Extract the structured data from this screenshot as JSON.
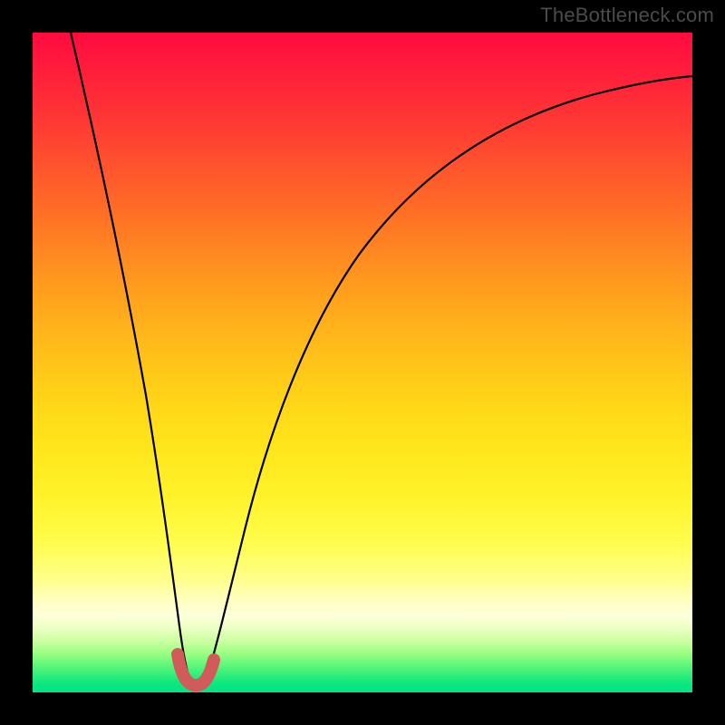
{
  "watermark": "TheBottleneck.com",
  "chart_data": {
    "type": "line",
    "title": "",
    "xlabel": "",
    "ylabel": "",
    "xlim": [
      0,
      100
    ],
    "ylim": [
      0,
      100
    ],
    "grid": false,
    "legend": false,
    "series": [
      {
        "name": "bottleneck-curve",
        "x": [
          0,
          3,
          6,
          9,
          12,
          15,
          18,
          21,
          23,
          25,
          28,
          32,
          36,
          40,
          45,
          50,
          55,
          60,
          65,
          70,
          75,
          80,
          85,
          90,
          95,
          100
        ],
        "values": [
          100,
          88,
          76,
          64,
          52,
          40,
          28,
          15,
          4,
          3,
          14,
          28,
          41,
          51,
          60,
          67,
          73,
          77,
          81,
          84,
          86,
          88,
          90,
          91,
          92,
          93
        ]
      }
    ],
    "marker": {
      "name": "optimal-range",
      "x_range": [
        21.5,
        26.5
      ],
      "y_range": [
        0,
        6
      ]
    },
    "colors": {
      "curve": "#000000",
      "marker": "#d15a5a",
      "gradient_top": "#ff0b3f",
      "gradient_bottom": "#03e584"
    }
  }
}
